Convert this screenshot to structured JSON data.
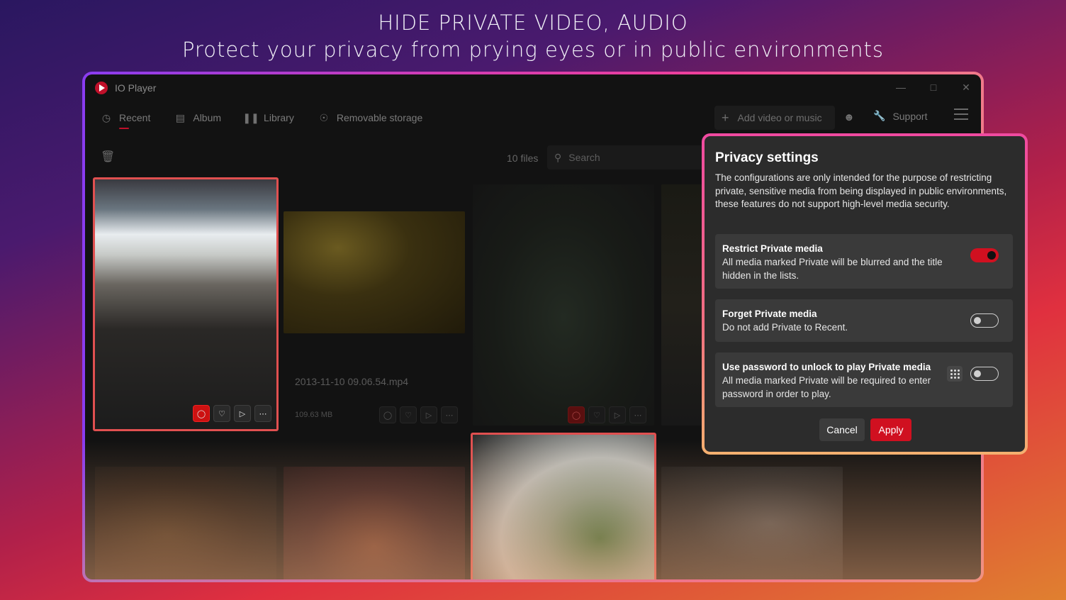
{
  "headline": {
    "line1": "HIDE PRIVATE VIDEO, AUDIO",
    "line2": "Protect your privacy from prying eyes or in public environments"
  },
  "app": {
    "title": "IO Player",
    "nav": [
      {
        "label": "Recent",
        "icon": "clock-icon",
        "active": true
      },
      {
        "label": "Album",
        "icon": "album-icon",
        "active": false
      },
      {
        "label": "Library",
        "icon": "library-icon",
        "active": false
      },
      {
        "label": "Removable storage",
        "icon": "disc-icon",
        "active": false
      }
    ],
    "add_label": "Add video or music",
    "support_label": "Support",
    "files_count": "10 files",
    "search_placeholder": "Search",
    "accent": "#d01020"
  },
  "media": [
    {
      "title": "",
      "size": "",
      "private": true
    },
    {
      "title": "2013-11-10 09.06.54.mp4",
      "size": "109.63 MB",
      "private": false
    },
    {
      "title": "",
      "size": "",
      "private": true
    },
    {
      "title": "",
      "size": "",
      "private": false
    },
    {
      "title": "",
      "size": "",
      "private": false
    },
    {
      "title": "",
      "size": "",
      "private": false
    },
    {
      "title": "",
      "size": "",
      "private": true
    },
    {
      "title": "",
      "size": "",
      "private": false
    }
  ],
  "privacy": {
    "title": "Privacy settings",
    "description": "The configurations are only intended for the purpose of restricting private, sensitive media from being displayed in public environments, these features do not support high-level media security.",
    "options": [
      {
        "title": "Restrict Private media",
        "description": "All media marked Private will be blurred and the title hidden in the lists.",
        "enabled": true
      },
      {
        "title": "Forget Private media",
        "description": "Do not add Private to Recent.",
        "enabled": false
      },
      {
        "title": "Use password to unlock to play Private media",
        "description": "All media marked Private will be required to enter password in order to play.",
        "enabled": false
      }
    ],
    "cancel_label": "Cancel",
    "apply_label": "Apply"
  }
}
